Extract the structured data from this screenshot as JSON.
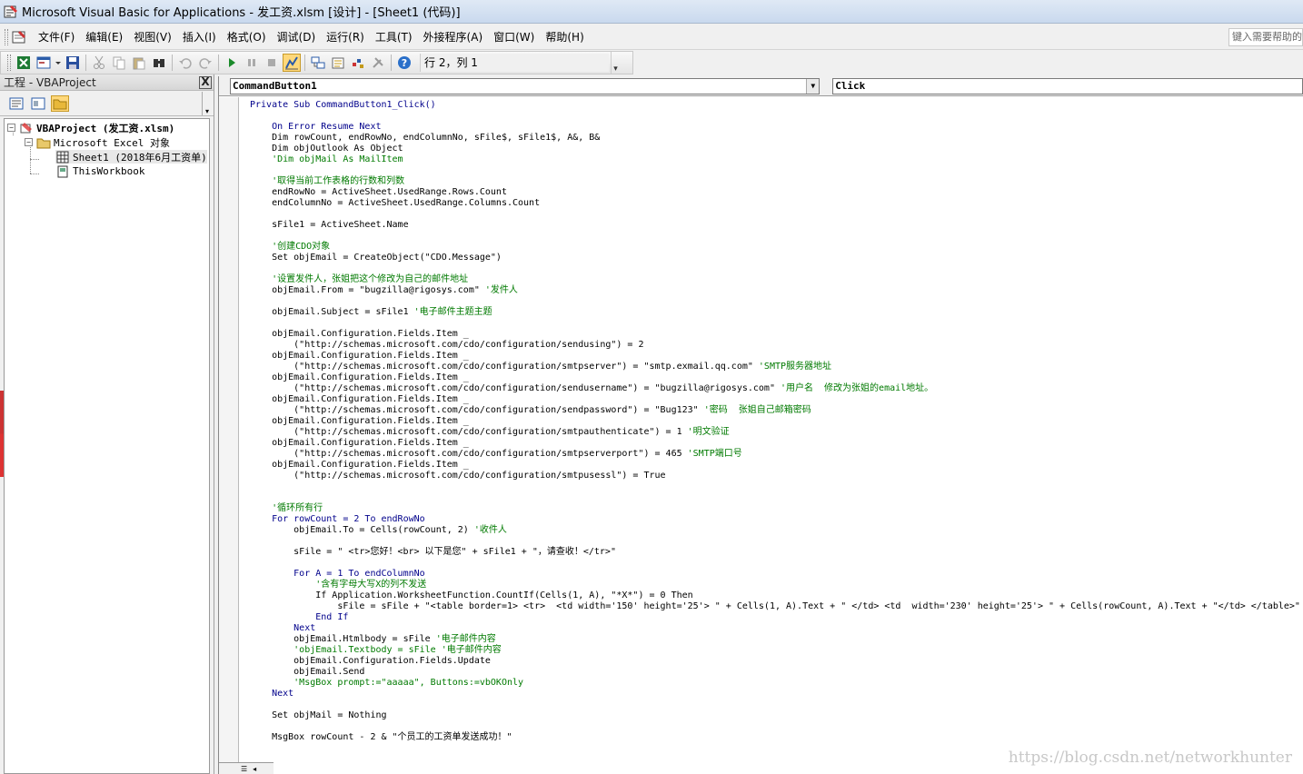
{
  "window": {
    "title": "Microsoft Visual Basic for Applications - 发工资.xlsm [设计] - [Sheet1 (代码)]"
  },
  "menu": {
    "items": [
      "文件(F)",
      "编辑(E)",
      "视图(V)",
      "插入(I)",
      "格式(O)",
      "调试(D)",
      "运行(R)",
      "工具(T)",
      "外接程序(A)",
      "窗口(W)",
      "帮助(H)"
    ],
    "help_placeholder": "键入需要帮助的"
  },
  "toolbar": {
    "cursor_position": "行 2，列 1"
  },
  "project_panel": {
    "title": "工程 - VBAProject",
    "close_label": "X",
    "tree": {
      "root": "VBAProject (发工资.xlsm)",
      "folder": "Microsoft Excel 对象",
      "sheet1": "Sheet1 (2018年6月工资单)",
      "thisworkbook": "ThisWorkbook"
    }
  },
  "code_window": {
    "object_combo": "CommandButton1",
    "procedure_combo": "Click",
    "lines": [
      {
        "t": "Private Sub CommandButton1_Click()",
        "c": "kw"
      },
      {
        "t": "",
        "c": ""
      },
      {
        "t": "    On Error Resume Next",
        "c": "kw"
      },
      {
        "t": "    Dim rowCount, endRowNo, endColumnNo, sFile$, sFile1$, A&, B&",
        "c": ""
      },
      {
        "t": "    Dim objOutlook As Object",
        "c": ""
      },
      {
        "t": "    'Dim objMail As MailItem",
        "c": "cm"
      },
      {
        "t": "",
        "c": ""
      },
      {
        "t": "    '取得当前工作表格的行数和列数",
        "c": "cm"
      },
      {
        "t": "    endRowNo = ActiveSheet.UsedRange.Rows.Count",
        "c": ""
      },
      {
        "t": "    endColumnNo = ActiveSheet.UsedRange.Columns.Count",
        "c": ""
      },
      {
        "t": "",
        "c": ""
      },
      {
        "t": "    sFile1 = ActiveSheet.Name",
        "c": ""
      },
      {
        "t": "",
        "c": ""
      },
      {
        "t": "    '创建CDO对象",
        "c": "cm"
      },
      {
        "t": "    Set objEmail = CreateObject(\"CDO.Message\")",
        "c": ""
      },
      {
        "t": "",
        "c": ""
      },
      {
        "t": "    '设置发件人，张姐把这个修改为自己的邮件地址",
        "c": "cm"
      },
      {
        "t": "    objEmail.From = \"bugzilla@rigosys.com\"",
        "c": "",
        "cm": " '发件人"
      },
      {
        "t": "",
        "c": ""
      },
      {
        "t": "    objEmail.Subject = sFile1",
        "c": "",
        "cm": " '电子邮件主题主题"
      },
      {
        "t": "",
        "c": ""
      },
      {
        "t": "    objEmail.Configuration.Fields.Item _",
        "c": ""
      },
      {
        "t": "        (\"http://schemas.microsoft.com/cdo/configuration/sendusing\") = 2",
        "c": ""
      },
      {
        "t": "    objEmail.Configuration.Fields.Item _",
        "c": ""
      },
      {
        "t": "        (\"http://schemas.microsoft.com/cdo/configuration/smtpserver\") = \"smtp.exmail.qq.com\"",
        "c": "",
        "cm": " 'SMTP服务器地址"
      },
      {
        "t": "    objEmail.Configuration.Fields.Item _",
        "c": ""
      },
      {
        "t": "        (\"http://schemas.microsoft.com/cdo/configuration/sendusername\") = \"bugzilla@rigosys.com\"",
        "c": "",
        "cm": " '用户名  修改为张姐的email地址。"
      },
      {
        "t": "    objEmail.Configuration.Fields.Item _",
        "c": ""
      },
      {
        "t": "        (\"http://schemas.microsoft.com/cdo/configuration/sendpassword\") = \"Bug123\"",
        "c": "",
        "cm": " '密码  张姐自己邮箱密码"
      },
      {
        "t": "    objEmail.Configuration.Fields.Item _",
        "c": ""
      },
      {
        "t": "        (\"http://schemas.microsoft.com/cdo/configuration/smtpauthenticate\") = 1",
        "c": "",
        "cm": " '明文验证"
      },
      {
        "t": "    objEmail.Configuration.Fields.Item _",
        "c": ""
      },
      {
        "t": "        (\"http://schemas.microsoft.com/cdo/configuration/smtpserverport\") = 465",
        "c": "",
        "cm": " 'SMTP端口号"
      },
      {
        "t": "    objEmail.Configuration.Fields.Item _",
        "c": ""
      },
      {
        "t": "        (\"http://schemas.microsoft.com/cdo/configuration/smtpusessl\") = True",
        "c": ""
      },
      {
        "t": "",
        "c": ""
      },
      {
        "t": "",
        "c": ""
      },
      {
        "t": "    '循环所有行",
        "c": "cm"
      },
      {
        "t": "    For rowCount = 2 To endRowNo",
        "c": "kw"
      },
      {
        "t": "        objEmail.To = Cells(rowCount, 2)",
        "c": "",
        "cm": " '收件人"
      },
      {
        "t": "",
        "c": ""
      },
      {
        "t": "        sFile = \" <tr>您好！<br> 以下是您\" + sFile1 + \"，请查收！</tr>\"",
        "c": ""
      },
      {
        "t": "",
        "c": ""
      },
      {
        "t": "        For A = 1 To endColumnNo",
        "c": "kw"
      },
      {
        "t": "            '含有字母大写X的列不发送",
        "c": "cm"
      },
      {
        "t": "            If Application.WorksheetFunction.CountIf(Cells(1, A), \"*X*\") = 0 Then",
        "c": ""
      },
      {
        "t": "                sFile = sFile + \"<table border=1> <tr>  <td width='150' height='25'> \" + Cells(1, A).Text + \" </td> <td  width='230' height='25'> \" + Cells(rowCount, A).Text + \"</td> </table>\"",
        "c": ""
      },
      {
        "t": "            End If",
        "c": "kw"
      },
      {
        "t": "        Next",
        "c": "kw"
      },
      {
        "t": "        objEmail.Htmlbody = sFile",
        "c": "",
        "cm": " '电子邮件内容"
      },
      {
        "t": "        'objEmail.Textbody = sFile '电子邮件内容",
        "c": "cm"
      },
      {
        "t": "        objEmail.Configuration.Fields.Update",
        "c": ""
      },
      {
        "t": "        objEmail.Send",
        "c": ""
      },
      {
        "t": "        'MsgBox prompt:=\"aaaaa\", Buttons:=vbOKOnly",
        "c": "cm"
      },
      {
        "t": "    Next",
        "c": "kw"
      },
      {
        "t": "",
        "c": ""
      },
      {
        "t": "    Set objMail = Nothing",
        "c": ""
      },
      {
        "t": "",
        "c": ""
      },
      {
        "t": "    MsgBox rowCount - 2 & \"个员工的工资单发送成功！\"",
        "c": ""
      }
    ]
  },
  "watermark": "https://blog.csdn.net/networkhunter",
  "colors": {
    "keyword": "#00008b",
    "comment": "#007a00",
    "active_tool": "#ffd87a"
  }
}
